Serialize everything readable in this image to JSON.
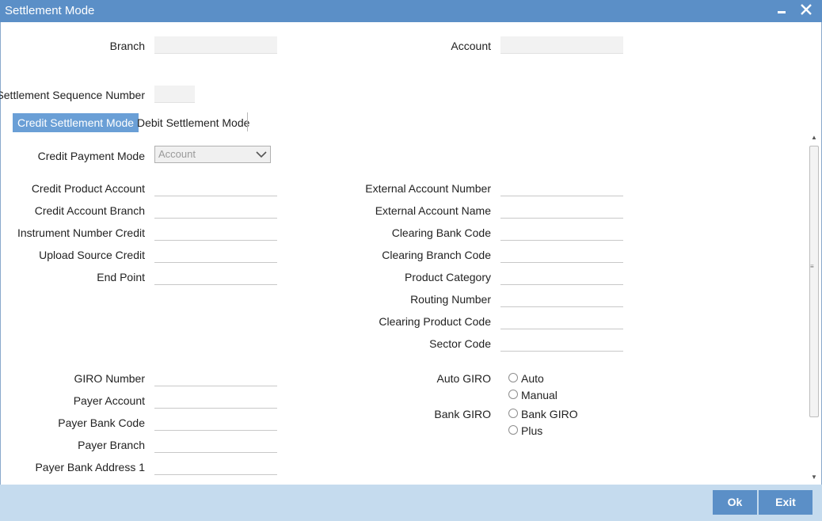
{
  "window": {
    "title": "Settlement Mode"
  },
  "header": {
    "branch_label": "Branch",
    "branch_value": "",
    "account_label": "Account",
    "account_value": "",
    "seq_label": "Settlement Sequence Number",
    "seq_value": ""
  },
  "tabs": [
    {
      "label": "Credit Settlement Mode",
      "active": true
    },
    {
      "label": "Debit Settlement Mode",
      "active": false
    }
  ],
  "payment_mode": {
    "label": "Credit Payment Mode",
    "selected": "Account"
  },
  "left_fields": [
    {
      "label": "Credit Product Account",
      "value": ""
    },
    {
      "label": "Credit Account Branch",
      "value": ""
    },
    {
      "label": "Instrument Number Credit",
      "value": ""
    },
    {
      "label": "Upload Source Credit",
      "value": ""
    },
    {
      "label": "End Point",
      "value": ""
    }
  ],
  "right_fields": [
    {
      "label": "External Account Number",
      "value": ""
    },
    {
      "label": "External Account Name",
      "value": ""
    },
    {
      "label": "Clearing Bank Code",
      "value": ""
    },
    {
      "label": "Clearing Branch Code",
      "value": ""
    },
    {
      "label": "Product Category",
      "value": ""
    },
    {
      "label": "Routing Number",
      "value": ""
    },
    {
      "label": "Clearing Product Code",
      "value": ""
    },
    {
      "label": "Sector Code",
      "value": ""
    }
  ],
  "giro_fields": [
    {
      "label": "GIRO Number",
      "value": ""
    },
    {
      "label": "Payer Account",
      "value": ""
    },
    {
      "label": "Payer Bank Code",
      "value": ""
    },
    {
      "label": "Payer Branch",
      "value": ""
    },
    {
      "label": "Payer Bank Address 1",
      "value": ""
    }
  ],
  "auto_giro": {
    "label": "Auto GIRO",
    "options": [
      "Auto",
      "Manual"
    ]
  },
  "bank_giro": {
    "label": "Bank GIRO",
    "options": [
      "Bank GIRO",
      "Plus"
    ]
  },
  "buttons": {
    "ok": "Ok",
    "exit": "Exit"
  }
}
